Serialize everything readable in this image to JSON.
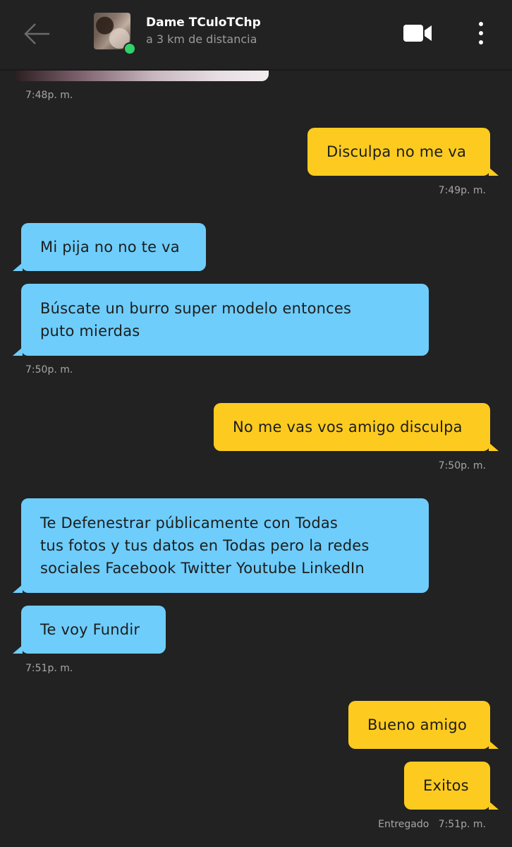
{
  "header": {
    "contact_name": "Dame TCuloTChp",
    "distance": "a 3 km de distancia",
    "icons": {
      "back": "back-arrow-icon",
      "video": "video-camera-icon",
      "more": "more-vert-icon"
    },
    "online_color": "#2fd36a"
  },
  "colors": {
    "background": "#222222",
    "incoming": "#6ecdfb",
    "outgoing": "#fdcb1f"
  },
  "messages": [
    {
      "dir": "in",
      "text": "Mi pija no no te va"
    },
    {
      "dir": "in",
      "text": "Búscate un burro super modelo entonces\nputo mierdas"
    },
    {
      "dir": "out",
      "text": "Disculpa no me va"
    },
    {
      "dir": "out",
      "text": "No me vas vos amigo disculpa"
    },
    {
      "dir": "in",
      "text": "Te Defenestrar públicamente con Todas\ntus fotos y tus datos en Todas pero la redes\nsociales Facebook Twitter Youtube LinkedIn"
    },
    {
      "dir": "in",
      "text": "Te voy Fundir"
    },
    {
      "dir": "out",
      "text": "Bueno amigo"
    },
    {
      "dir": "out",
      "text": "Exitos"
    }
  ],
  "timestamps": [
    "7:48p. m.",
    "7:49p. m.",
    "7:50p. m.",
    "7:50p. m.",
    "7:51p. m.",
    "7:51p. m."
  ],
  "delivery_status": "Entregado"
}
